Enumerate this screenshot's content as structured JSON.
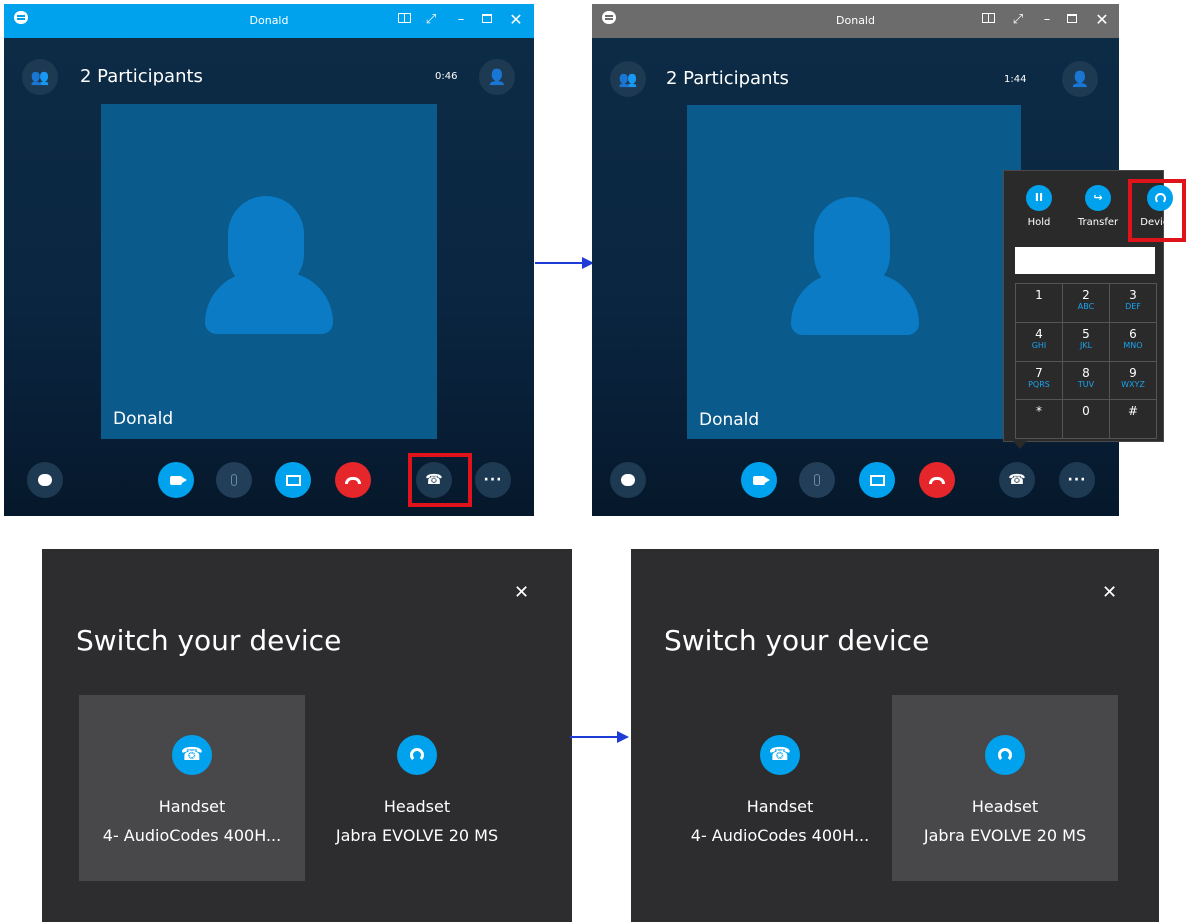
{
  "window_left": {
    "title": "Donald",
    "participants": "2 Participants",
    "timer": "0:46",
    "tile_name": "Donald"
  },
  "window_right": {
    "title": "Donald",
    "participants": "2 Participants",
    "timer": "1:44",
    "tile_name": "Donald"
  },
  "popup": {
    "actions": [
      {
        "label": "Hold",
        "icon": "pause-icon"
      },
      {
        "label": "Transfer",
        "icon": "transfer-icon"
      },
      {
        "label": "Devices",
        "icon": "headset-icon"
      }
    ],
    "dial_value": "",
    "keys": [
      {
        "digit": "1",
        "letters": ""
      },
      {
        "digit": "2",
        "letters": "ABC"
      },
      {
        "digit": "3",
        "letters": "DEF"
      },
      {
        "digit": "4",
        "letters": "GHI"
      },
      {
        "digit": "5",
        "letters": "JKL"
      },
      {
        "digit": "6",
        "letters": "MNO"
      },
      {
        "digit": "7",
        "letters": "PQRS"
      },
      {
        "digit": "8",
        "letters": "TUV"
      },
      {
        "digit": "9",
        "letters": "WXYZ"
      },
      {
        "digit": "*",
        "letters": ""
      },
      {
        "digit": "0",
        "letters": ""
      },
      {
        "digit": "#",
        "letters": ""
      }
    ]
  },
  "switch_left": {
    "close": "✕",
    "title": "Switch your device",
    "devices": [
      {
        "name": "Handset",
        "model": "4- AudioCodes 400H...",
        "icon": "phone-icon"
      },
      {
        "name": "Headset",
        "model": "Jabra EVOLVE 20 MS",
        "icon": "headset-icon"
      }
    ]
  },
  "switch_right": {
    "close": "✕",
    "title": "Switch your device",
    "devices": [
      {
        "name": "Handset",
        "model": "4- AudioCodes 400H...",
        "icon": "phone-icon"
      },
      {
        "name": "Headset",
        "model": "Jabra EVOLVE 20 MS",
        "icon": "headset-icon"
      }
    ]
  },
  "colors": {
    "accent": "#00a2ed",
    "hangup": "#e5262b",
    "highlight_box": "#e0131a",
    "arrow": "#1f3bd6",
    "panel_bg": "#2d2d30"
  }
}
